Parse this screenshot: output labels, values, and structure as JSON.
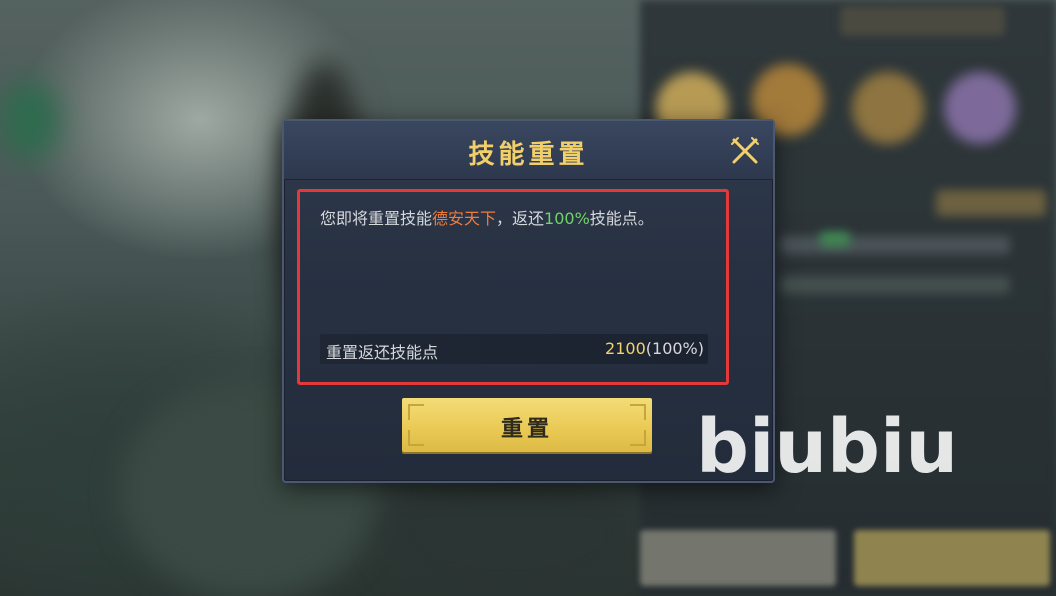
{
  "dialog": {
    "title": "技能重置",
    "message_before": "您即将重置技能",
    "skill_name": "德安天下",
    "message_middle": "，返还",
    "refund_percent_text": "100%",
    "message_after": "技能点。",
    "refund_label": "重置返还技能点",
    "refund_points": "2100",
    "refund_points_suffix": "(100%)",
    "reset_button_label": "重置",
    "close_icon": "close-icon"
  },
  "watermark": {
    "text": "biubiu"
  },
  "colors": {
    "title": "#f1cf6a",
    "skill_name": "#f07c3c",
    "percent": "#6fd36a",
    "highlight_border": "#e53939",
    "button": "#e9c953"
  }
}
